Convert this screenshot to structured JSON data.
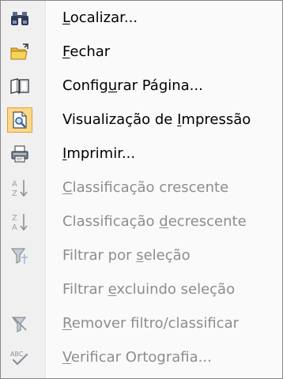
{
  "menu": {
    "items": [
      {
        "id": "localizar",
        "before": "",
        "accel": "L",
        "after": "ocalizar...",
        "icon": "binoculars-icon",
        "enabled": true,
        "checked": false
      },
      {
        "id": "fechar",
        "before": "",
        "accel": "F",
        "after": "echar",
        "icon": "folder-close-icon",
        "enabled": true,
        "checked": false
      },
      {
        "id": "configurar-pagina",
        "before": "Config",
        "accel": "u",
        "after": "rar Página...",
        "icon": "page-setup-icon",
        "enabled": true,
        "checked": false
      },
      {
        "id": "visualizacao-impressao",
        "before": "Visualização de ",
        "accel": "I",
        "after": "mpressão",
        "icon": "print-preview-icon",
        "enabled": true,
        "checked": true
      },
      {
        "id": "imprimir",
        "before": "",
        "accel": "I",
        "after": "mprimir...",
        "icon": "printer-icon",
        "enabled": true,
        "checked": false
      },
      {
        "id": "classificacao-crescente",
        "before": "",
        "accel": "C",
        "after": "lassificação crescente",
        "icon": "sort-ascending-icon",
        "enabled": false,
        "checked": false
      },
      {
        "id": "classificacao-decrescente",
        "before": "Classificação ",
        "accel": "d",
        "after": "ecrescente",
        "icon": "sort-descending-icon",
        "enabled": false,
        "checked": false
      },
      {
        "id": "filtrar-selecao",
        "before": "Filtrar por ",
        "accel": "s",
        "after": "eleção",
        "icon": "filter-selection-icon",
        "enabled": false,
        "checked": false
      },
      {
        "id": "filtrar-excluindo",
        "before": "Filtrar ",
        "accel": "e",
        "after": "xcluindo seleção",
        "icon": "",
        "enabled": false,
        "checked": false
      },
      {
        "id": "remover-filtro",
        "before": "",
        "accel": "R",
        "after": "emover filtro/classificar",
        "icon": "remove-filter-icon",
        "enabled": false,
        "checked": false
      },
      {
        "id": "verificar-ortografia",
        "before": "",
        "accel": "V",
        "after": "erificar Ortografia...",
        "icon": "spelling-check-icon",
        "enabled": false,
        "checked": false
      }
    ],
    "colors": {
      "checked_fill": "#fbd98a",
      "checked_border": "#e79a3b",
      "disabled_text": "#8d8d8d",
      "border": "#868686"
    }
  }
}
